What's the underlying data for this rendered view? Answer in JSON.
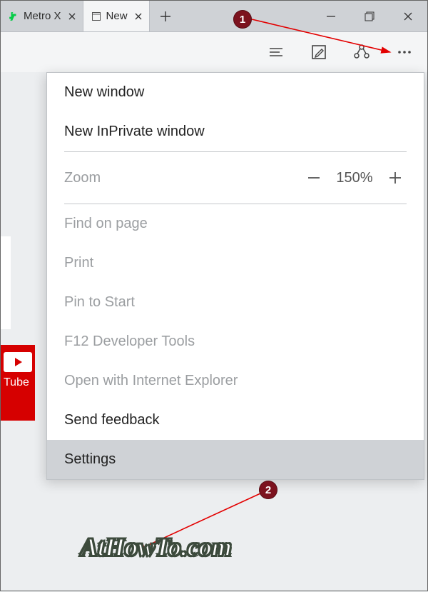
{
  "tabs": [
    {
      "label": "Metro X",
      "favicon": "deviantart"
    },
    {
      "label": "New",
      "favicon": "page",
      "active": true
    }
  ],
  "window_controls": {
    "min": "minimize",
    "max": "restore",
    "close": "close"
  },
  "toolbar": {
    "reading_list": "reading-list-icon",
    "notes": "notes-icon",
    "share": "share-icon",
    "more": "more-icon"
  },
  "menu": {
    "new_window": "New window",
    "new_inprivate": "New InPrivate window",
    "zoom_label": "Zoom",
    "zoom_value": "150%",
    "find_on_page": "Find on page",
    "print": "Print",
    "pin_to_start": "Pin to Start",
    "dev_tools": "F12 Developer Tools",
    "open_ie": "Open with Internet Explorer",
    "send_feedback": "Send feedback",
    "settings": "Settings"
  },
  "sidebar": {
    "youtube_label": "Tube"
  },
  "annotations": {
    "marker1": "1",
    "marker2": "2"
  },
  "watermark": "AtHowTo.com"
}
